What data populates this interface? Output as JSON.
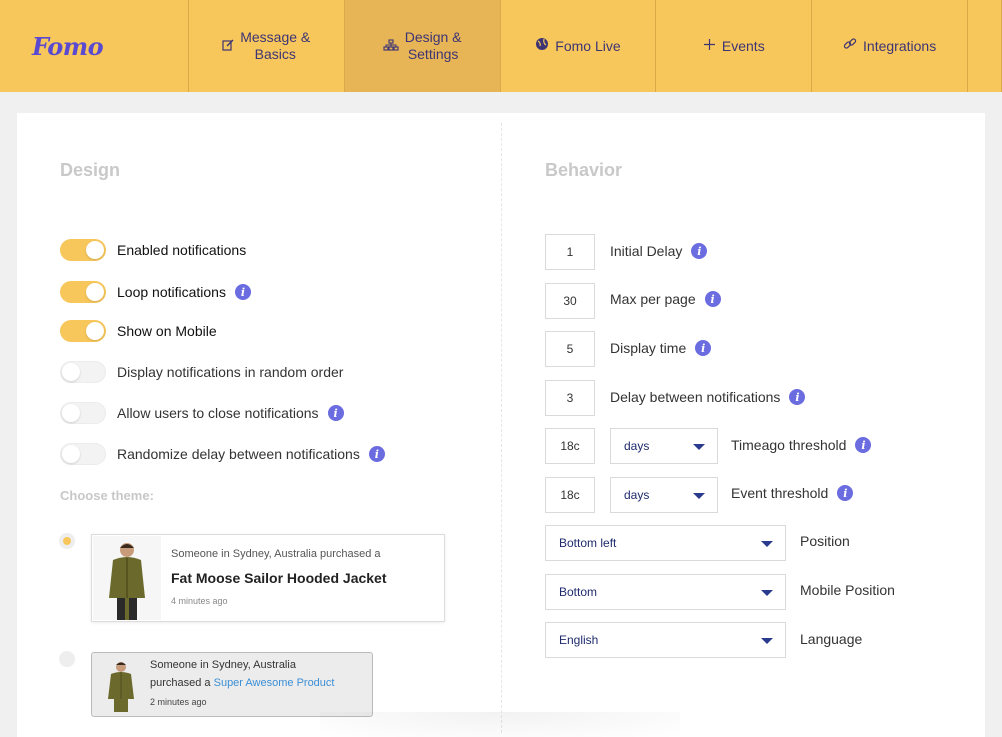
{
  "header": {
    "logo": "Fomo",
    "nav": [
      {
        "label_line1": "Message &",
        "label_line2": "Basics",
        "icon": "edit-icon"
      },
      {
        "label_line1": "Design &",
        "label_line2": "Settings",
        "icon": "sitemap-icon"
      },
      {
        "label_line1": "Fomo Live",
        "label_line2": "",
        "icon": "globe-icon"
      },
      {
        "label_line1": "Events",
        "label_line2": "",
        "icon": "plus-icon"
      },
      {
        "label_line1": "Integrations",
        "label_line2": "",
        "icon": "link-icon"
      }
    ],
    "active_index": 1
  },
  "design": {
    "title": "Design",
    "toggles": [
      {
        "label": "Enabled notifications",
        "on": true,
        "info": false
      },
      {
        "label": "Loop notifications",
        "on": true,
        "info": true
      },
      {
        "label": "Show on Mobile",
        "on": true,
        "info": false
      },
      {
        "label": "Display notifications in random order",
        "on": false,
        "info": false
      },
      {
        "label": "Allow users to close notifications",
        "on": false,
        "info": true
      },
      {
        "label": "Randomize delay between notifications",
        "on": false,
        "info": true
      }
    ],
    "choose_theme": "Choose theme:",
    "theme1": {
      "line1": "Someone in Sydney, Australia purchased a",
      "product": "Fat Moose Sailor Hooded Jacket",
      "time": "4 minutes ago",
      "selected": true
    },
    "theme2": {
      "line1": "Someone in Sydney, Australia",
      "line2_prefix": "purchased a",
      "line2_link": "Super Awesome Product",
      "time": "2 minutes ago",
      "selected": false
    }
  },
  "behavior": {
    "title": "Behavior",
    "fields": [
      {
        "value": "1",
        "label": "Initial Delay",
        "info": true
      },
      {
        "value": "30",
        "label": "Max per page",
        "info": true
      },
      {
        "value": "5",
        "label": "Display time",
        "info": true
      },
      {
        "value": "3",
        "label": "Delay between notifications",
        "info": true
      }
    ],
    "thresholds": [
      {
        "value": "18c",
        "unit": "days",
        "label": "Timeago threshold",
        "info": true
      },
      {
        "value": "18c",
        "unit": "days",
        "label": "Event threshold",
        "info": true
      }
    ],
    "selects": [
      {
        "value": "Bottom left",
        "label": "Position"
      },
      {
        "value": "Bottom",
        "label": "Mobile Position"
      },
      {
        "value": "English",
        "label": "Language"
      }
    ]
  },
  "colors": {
    "accent": "#f8c75b",
    "brand": "#5a4ad1",
    "info": "#6b6ce0"
  }
}
